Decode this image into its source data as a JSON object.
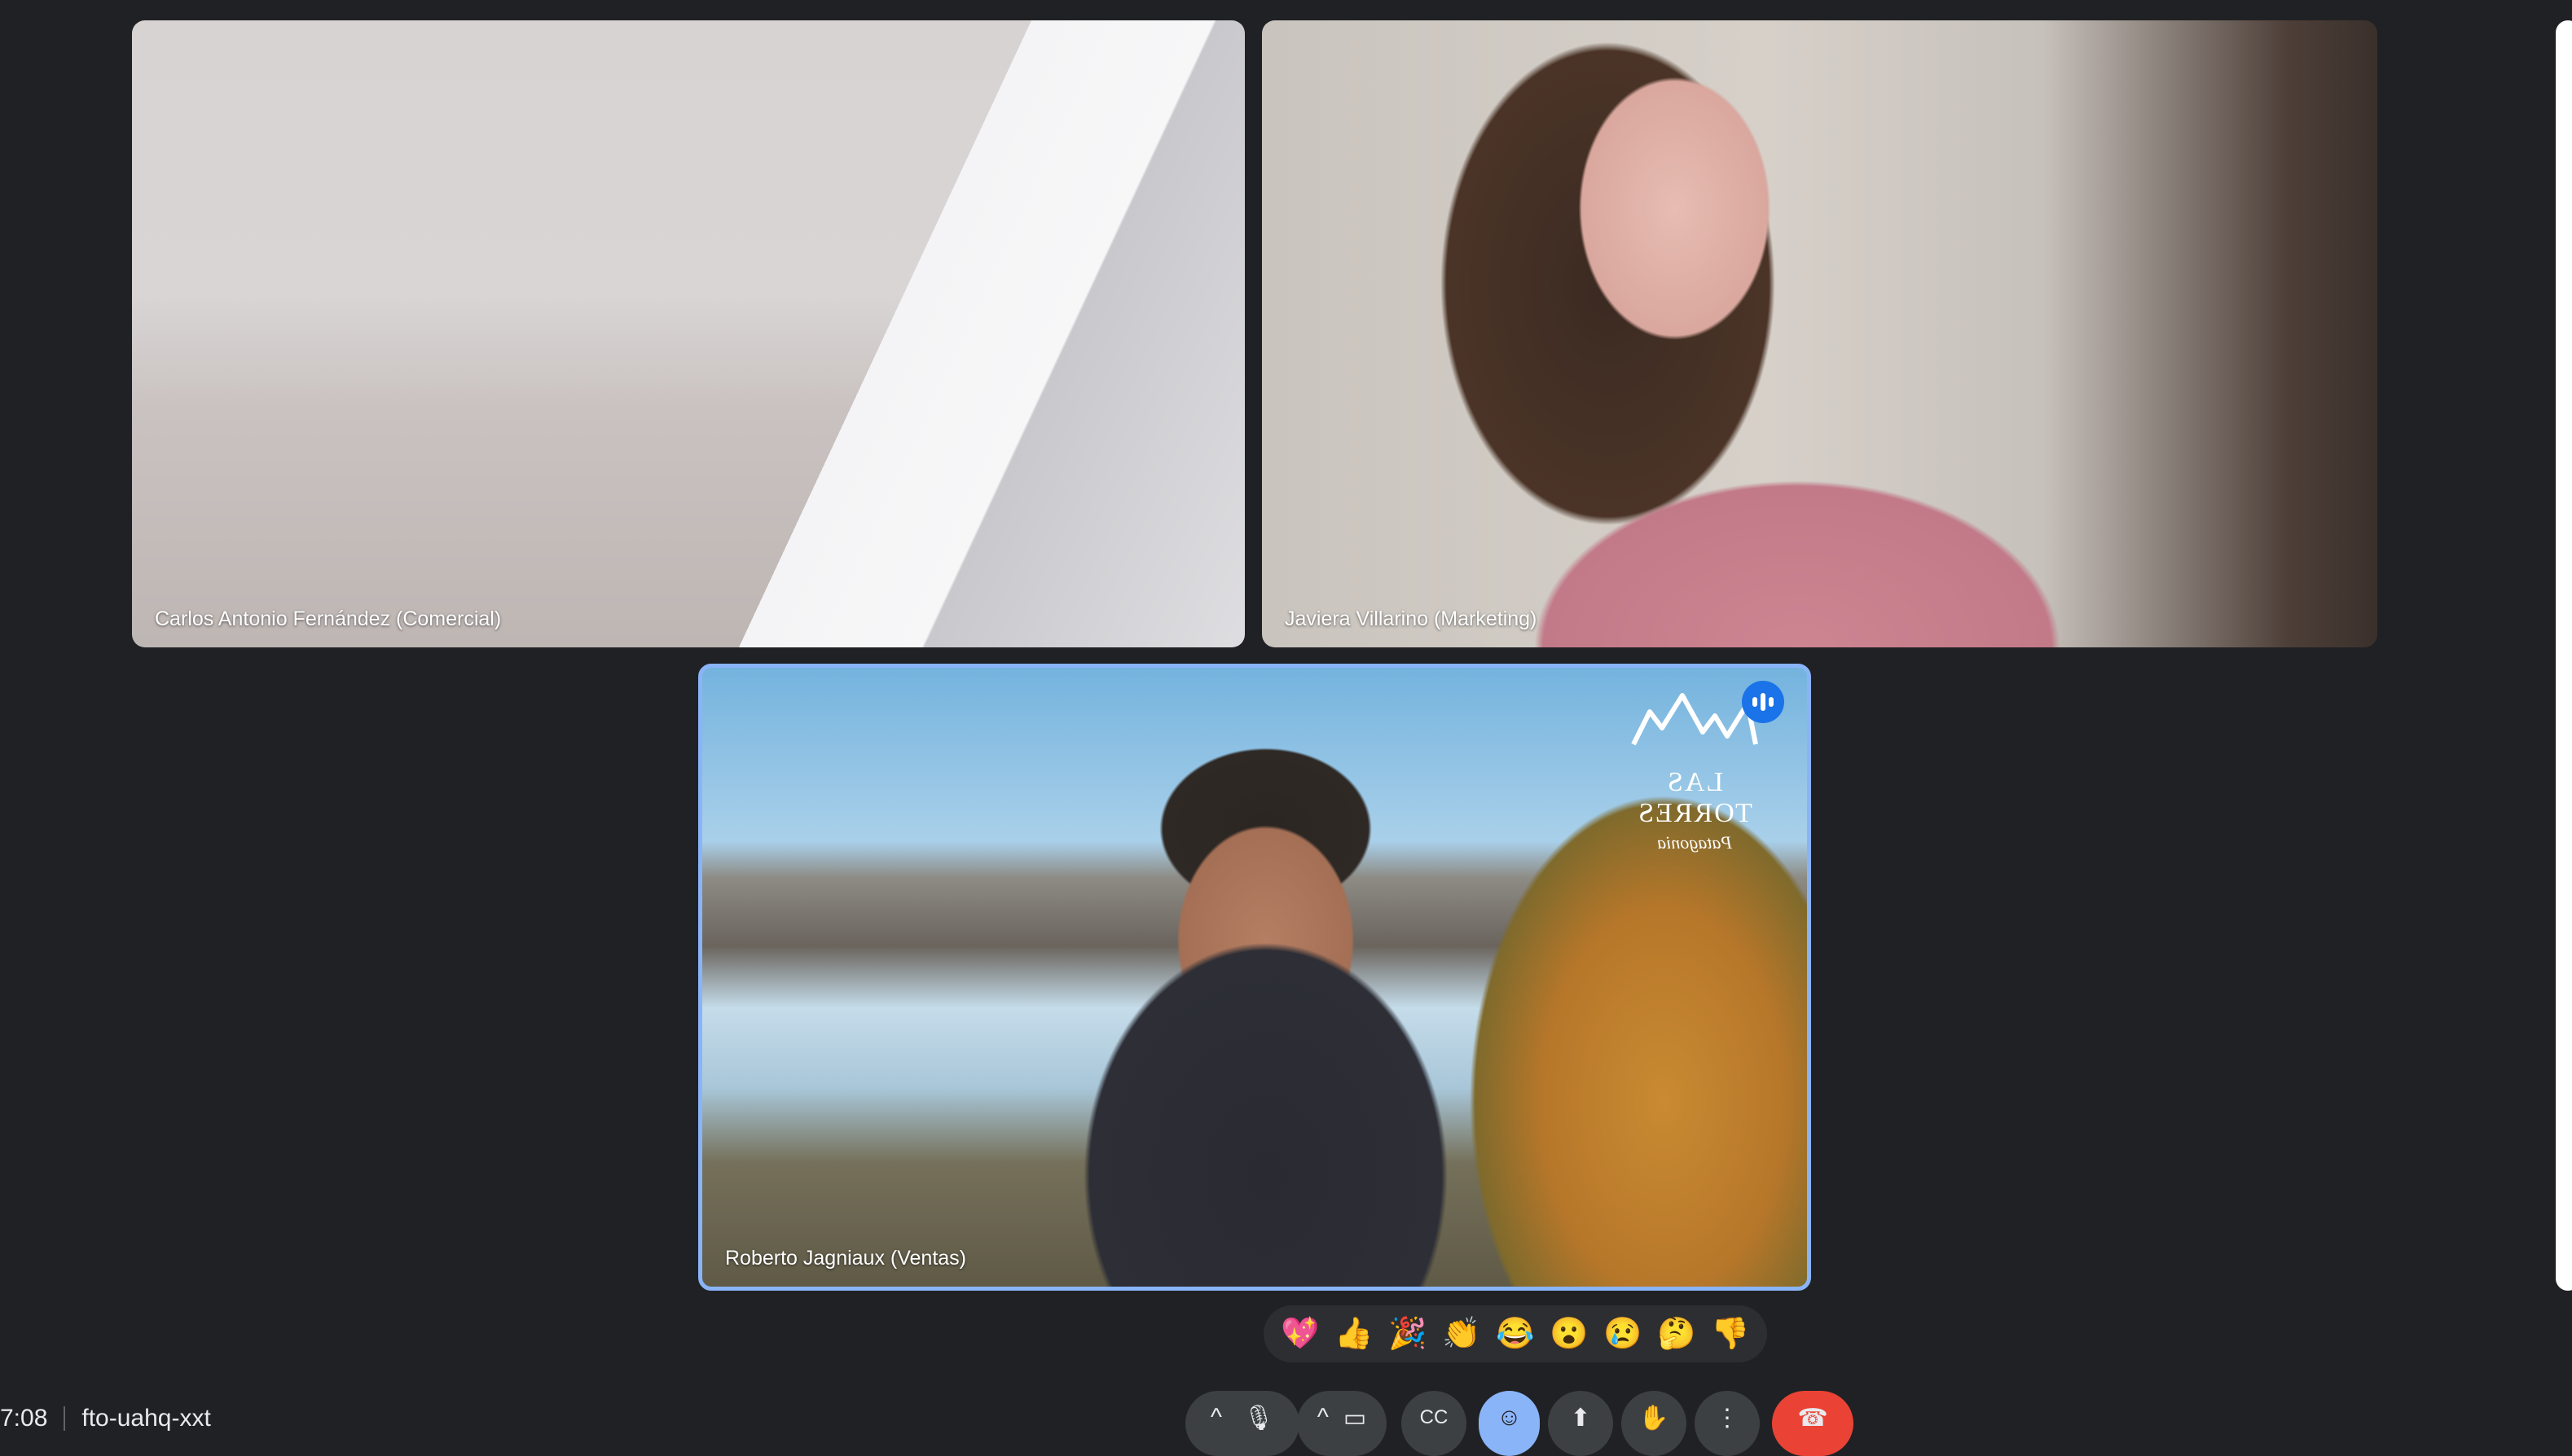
{
  "participants": [
    {
      "name": "Carlos Antonio Fernández (Comercial)"
    },
    {
      "name": "Javiera Villarino (Marketing)"
    },
    {
      "name": "Roberto Jagniaux (Ventas)",
      "speaking": true
    }
  ],
  "background_logo": {
    "title": "LAS TORRES",
    "subtitle": "Patagonia"
  },
  "reactions": [
    "💖",
    "👍",
    "🎉",
    "👏",
    "😂",
    "😮",
    "😢",
    "🤔",
    "👎"
  ],
  "meeting": {
    "time": "7:08",
    "code": "fto-uahq-xxt"
  },
  "controls": [
    {
      "name": "mic-options",
      "glyph": "^"
    },
    {
      "name": "mic",
      "glyph": "🎙"
    },
    {
      "name": "camera-options",
      "glyph": "^"
    },
    {
      "name": "camera",
      "glyph": "▭"
    },
    {
      "name": "captions",
      "glyph": "CC"
    },
    {
      "name": "reactions",
      "glyph": "☺"
    },
    {
      "name": "present",
      "glyph": "⬆"
    },
    {
      "name": "raise-hand",
      "glyph": "✋"
    },
    {
      "name": "more-options",
      "glyph": "⋮"
    },
    {
      "name": "leave-call",
      "glyph": "☎"
    }
  ],
  "colors": {
    "background": "#202124",
    "active_speaker_border": "#8ab4f8",
    "speaking_indicator": "#1a73e8",
    "leave_call": "#ea4335",
    "reactions_active": "#8ab4f8"
  }
}
